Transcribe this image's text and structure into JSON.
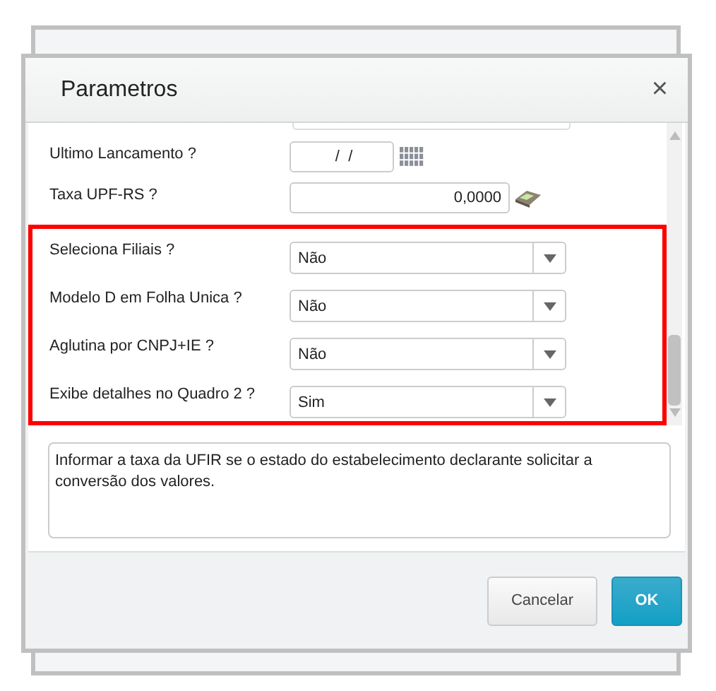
{
  "dialog": {
    "title": "Parametros",
    "close": "×"
  },
  "fields": [
    {
      "kind": "date",
      "label": "Ultimo Lancamento ?",
      "value": " /  /"
    },
    {
      "kind": "number",
      "label": "Taxa UPF-RS ?",
      "value": "0,0000"
    }
  ],
  "highlight_group": {
    "fields": [
      {
        "kind": "select",
        "label": "Seleciona Filiais ?",
        "value": "Não"
      },
      {
        "kind": "select",
        "label": "Modelo D em Folha Unica ?",
        "value": "Não"
      },
      {
        "kind": "select",
        "label": "Aglutina por CNPJ+IE ?",
        "value": "Não"
      },
      {
        "kind": "select",
        "label": "Exibe detalhes no Quadro 2 ?",
        "value": "Sim"
      }
    ]
  },
  "help_text": "Informar a taxa da UFIR se o estado do estabelecimento declarante solicitar a conversão dos valores.",
  "buttons": [
    {
      "label": "Cancelar",
      "kind": "secondary"
    },
    {
      "label": "OK",
      "kind": "primary"
    }
  ]
}
